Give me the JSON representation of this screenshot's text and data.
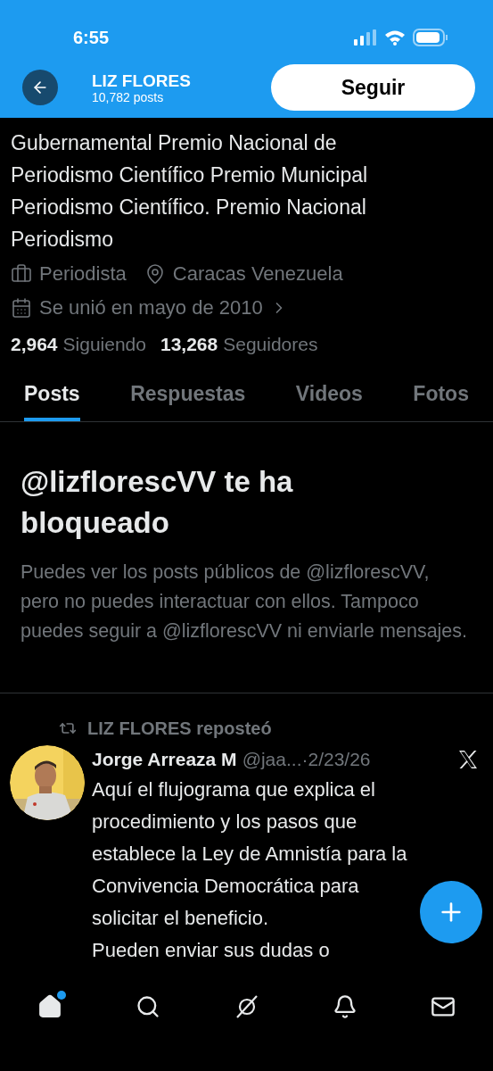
{
  "status_bar": {
    "time": "6:55"
  },
  "header": {
    "name": "LIZ FLORES",
    "posts": "10,782 posts",
    "follow_button": "Seguir"
  },
  "bio": "Gubernamental Premio Nacional de Periodismo Científico Premio Municipal Periodismo Científico. Premio Nacional Periodismo",
  "meta": [
    {
      "kind": "job",
      "text": "Periodista"
    },
    {
      "kind": "location",
      "text": "Caracas Venezuela"
    },
    {
      "kind": "joined",
      "text": "Se unió en mayo de 2010"
    }
  ],
  "stats": [
    {
      "count": "2,964",
      "label": "Siguiendo"
    },
    {
      "count": "13,268",
      "label": "Seguidores"
    }
  ],
  "tabs": [
    {
      "label": "Posts",
      "selected": true
    },
    {
      "label": "Respuestas",
      "selected": false
    },
    {
      "label": "Videos",
      "selected": false
    },
    {
      "label": "Fotos",
      "selected": false
    }
  ],
  "blocked": {
    "title": "@lizflorescVV te ha bloqueado",
    "text": "Puedes ver los posts públicos de @lizflorescVV, pero no puedes interactuar con ellos. Tampoco puedes seguir a @lizflorescVV ni enviarle mensajes."
  },
  "post": {
    "repost_label": "LIZ FLORES reposteó",
    "author": "Jorge Arreaza M",
    "handle": "@jaa...",
    "date": "·2/23/26",
    "text": [
      "Aquí el flujograma que explica el procedimiento y los pasos que establece la Ley de Amnistía para la Convivencia Democrática para solicitar el beneficio.",
      "Pueden enviar sus dudas o"
    ],
    "avatar": {
      "kind": "picture"
    }
  },
  "nav": [
    {
      "kind": "home",
      "selected": true,
      "badge": true
    },
    {
      "kind": "search",
      "selected": false,
      "badge": false
    },
    {
      "kind": "grok",
      "selected": false,
      "badge": false
    },
    {
      "kind": "bell",
      "selected": false,
      "badge": false
    },
    {
      "kind": "mail",
      "selected": false,
      "badge": false
    }
  ]
}
